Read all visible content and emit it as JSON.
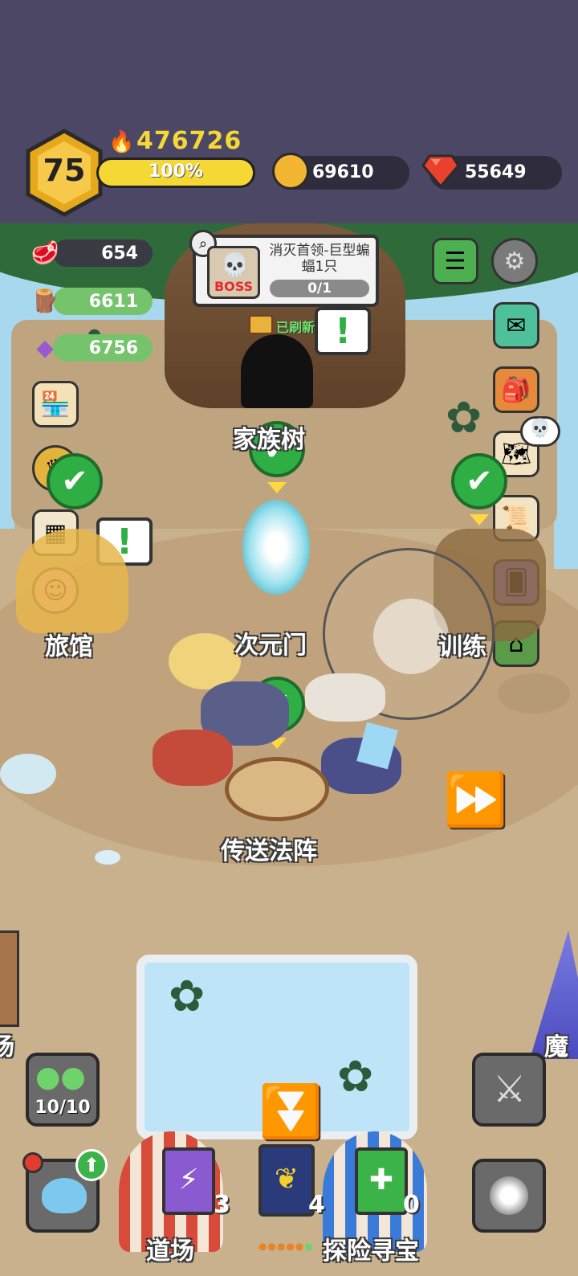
{
  "header": {
    "level": "75",
    "power": "476726",
    "exp_percent": "100%",
    "exp_fraction": 1.0,
    "gold": "69610",
    "gems": "55649"
  },
  "resources": [
    {
      "name": "meat-icon",
      "value": "654"
    },
    {
      "name": "wood-icon",
      "value": "6611"
    },
    {
      "name": "crystal-icon",
      "value": "6756"
    }
  ],
  "quest": {
    "boss_tag": "BOSS",
    "title": "消灭首领-巨型蝙蝠1只",
    "progress": "0/1",
    "refreshed": "已刷新"
  },
  "locations": {
    "tree": "家族树",
    "portal": "次元门",
    "inn": "旅馆",
    "training": "训练",
    "teleport": "传送法阵",
    "dojo": "道场",
    "explore": "探险寻宝",
    "left_edge": "场",
    "right_edge": "魔"
  },
  "bottom": {
    "slime_count": "10/10",
    "book_counts": [
      "3",
      "4",
      "0"
    ]
  },
  "colors": {
    "topbar": "#4c4764",
    "ground": "#c9b18e",
    "check_green": "#2fae44",
    "exp_yellow": "#f6d835",
    "level_hex": "#e6a91b"
  }
}
